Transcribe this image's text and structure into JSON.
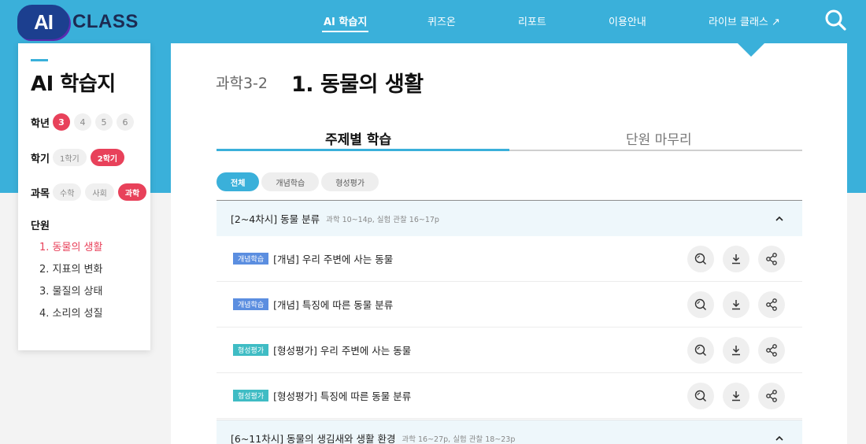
{
  "header": {
    "logo": {
      "mark": "AI",
      "text": "CLASS"
    },
    "nav": [
      {
        "label": "AI 학습지",
        "active": true
      },
      {
        "label": "퀴즈온",
        "active": false
      },
      {
        "label": "리포트",
        "active": false
      },
      {
        "label": "이용안내",
        "active": false
      },
      {
        "label": "라이브 클래스 ↗",
        "active": false
      }
    ]
  },
  "sidebar": {
    "title": "AI 학습지",
    "grade": {
      "label": "학년",
      "options": [
        "3",
        "4",
        "5",
        "6"
      ],
      "selected": "3"
    },
    "semester": {
      "label": "학기",
      "options": [
        "1학기",
        "2학기"
      ],
      "selected": "2학기"
    },
    "subject": {
      "label": "과목",
      "options": [
        "수학",
        "사회",
        "과학"
      ],
      "selected": "과학"
    },
    "units": {
      "label": "단원",
      "items": [
        "1. 동물의 생활",
        "2. 지표의 변화",
        "3. 물질의 상태",
        "4. 소리의 성질"
      ],
      "selected": "1. 동물의 생활"
    }
  },
  "main": {
    "subject_code": "과학3-2",
    "title": "1. 동물의 생활",
    "tabs": [
      {
        "label": "주제별 학습",
        "active": true
      },
      {
        "label": "단원 마무리",
        "active": false
      }
    ],
    "filters": [
      {
        "label": "전체",
        "active": true
      },
      {
        "label": "개념학습",
        "active": false
      },
      {
        "label": "형성평가",
        "active": false
      }
    ],
    "groups": [
      {
        "title": "[2~4차시] 동물 분류",
        "pages": "과학 10~14p, 실험 관찰 16~17p",
        "expanded": true,
        "items": [
          {
            "badge": "개념학습",
            "badge_color": "#5b8ee0",
            "title": "[개념] 우리 주변에 사는 동물"
          },
          {
            "badge": "개념학습",
            "badge_color": "#5b8ee0",
            "title": "[개념] 특징에 따른 동물 분류"
          },
          {
            "badge": "형성평가",
            "badge_color": "#3fbcc4",
            "title": "[형성평가] 우리 주변에 사는 동물"
          },
          {
            "badge": "형성평가",
            "badge_color": "#3fbcc4",
            "title": "[형성평가] 특징에 따른 동물 분류"
          }
        ]
      },
      {
        "title": "[6~11차시] 동물의 생김새와 생활 환경",
        "pages": "과학 16~27p, 실험 관찰 18~23p",
        "expanded": true,
        "items": []
      }
    ],
    "row_actions": [
      "preview-icon",
      "download-icon",
      "share-icon"
    ]
  },
  "colors": {
    "primary": "#3ab0da",
    "accent": "#e8415a",
    "concept_badge": "#5b8ee0",
    "quiz_badge": "#3fbcc4"
  }
}
